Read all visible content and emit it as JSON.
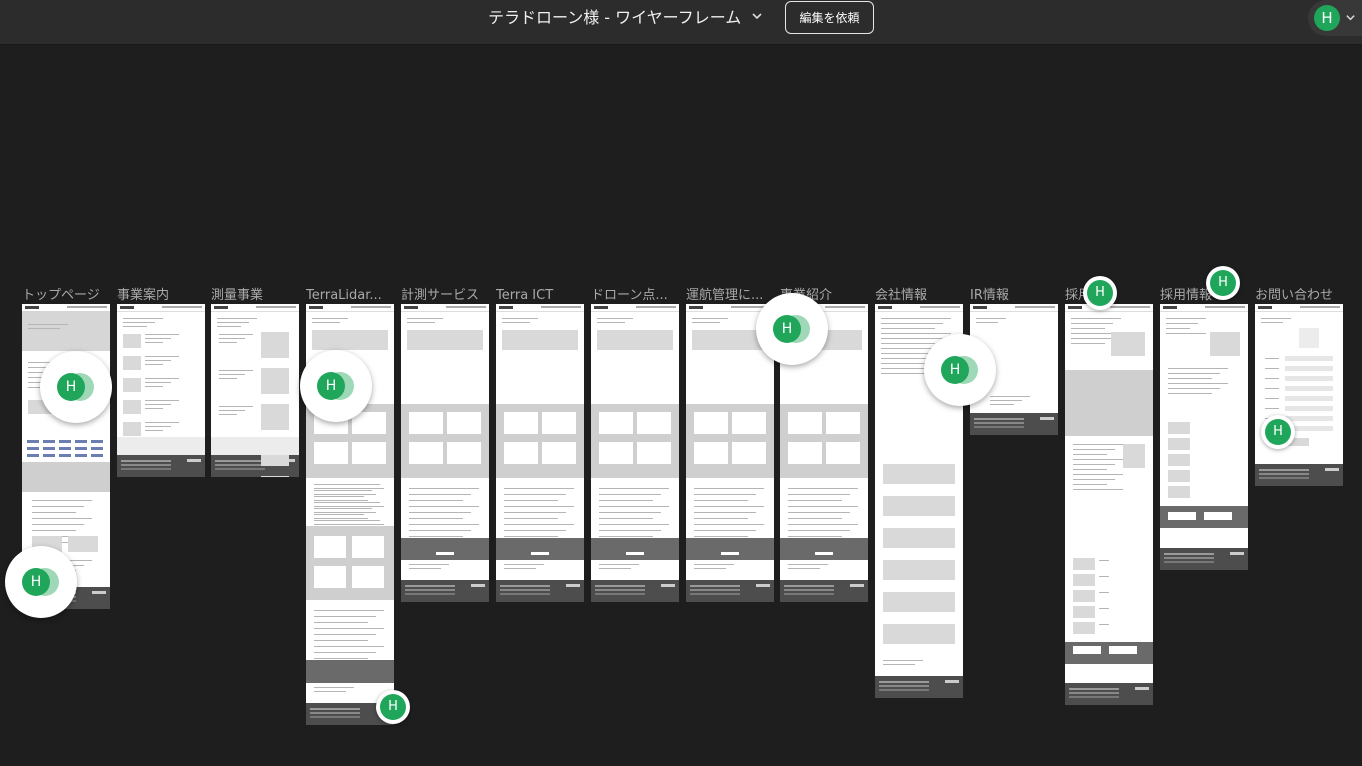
{
  "header": {
    "document_title": "テラドローン様 - ワイヤーフレーム",
    "request_edit_label": "編集を依頼",
    "user_initial": "H"
  },
  "frames": [
    {
      "label": "トップページ"
    },
    {
      "label": "事業案内"
    },
    {
      "label": "測量事業"
    },
    {
      "label": "TerraLidar..."
    },
    {
      "label": "計測サービス"
    },
    {
      "label": "Terra ICT"
    },
    {
      "label": "ドローン点..."
    },
    {
      "label": "運航管理に..."
    },
    {
      "label": "事業紹介"
    },
    {
      "label": "会社情報"
    },
    {
      "label": "IR情報"
    },
    {
      "label": "採用"
    },
    {
      "label": "採用情報"
    },
    {
      "label": "お問い合わせ"
    }
  ],
  "collaborators": {
    "initial": "H",
    "color": "#1fa65a"
  },
  "icons": {
    "title_dropdown": "chevron-down-icon",
    "user_menu_dropdown": "chevron-down-icon"
  }
}
